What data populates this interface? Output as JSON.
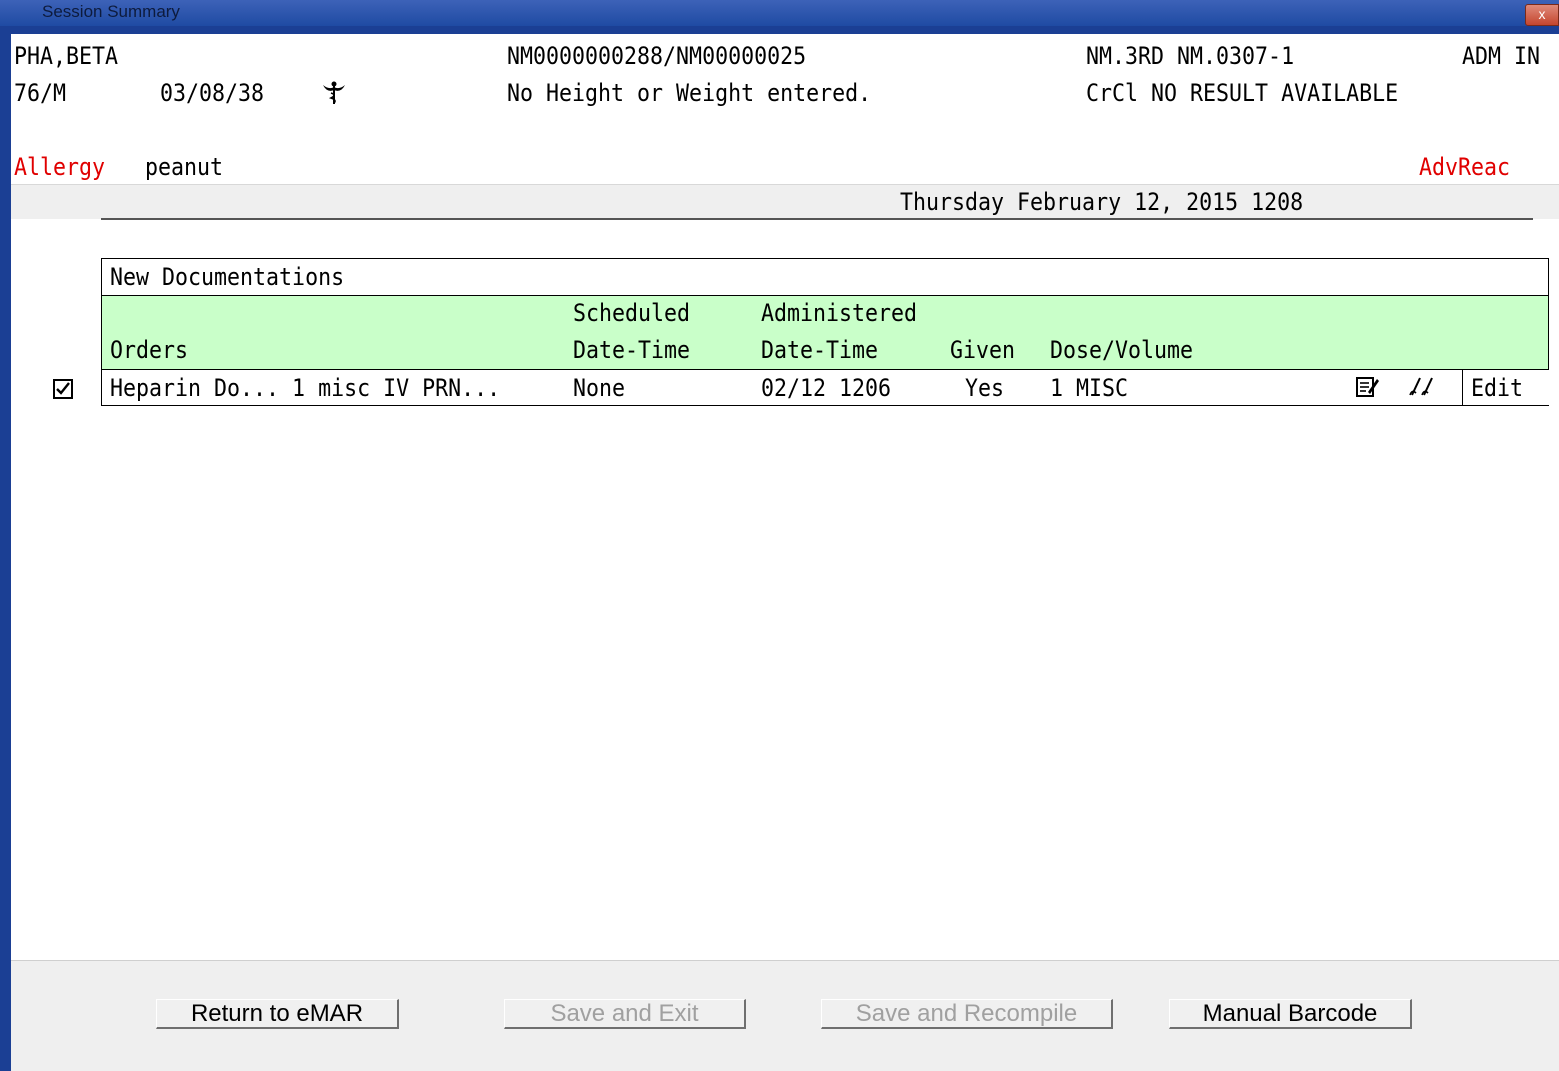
{
  "window": {
    "title": "Session Summary",
    "close_label": "x"
  },
  "patient": {
    "name": "PHA,BETA",
    "age_sex": "76/M",
    "dob": "03/08/38",
    "ids": "NM0000000288/NM00000025",
    "height_weight": "No Height or Weight entered.",
    "location": "NM.3RD NM.0307-1",
    "status": "ADM IN",
    "crcl": "CrCl NO RESULT AVAILABLE",
    "allergy_label": "Allergy",
    "allergy_value": "peanut",
    "adv_reac_label": "AdvReac"
  },
  "datetime": "Thursday February 12, 2015 1208",
  "table": {
    "title": "New Documentations",
    "headers": {
      "orders": "Orders",
      "scheduled_top": "Scheduled",
      "scheduled_bottom": "Date-Time",
      "administered_top": "Administered",
      "administered_bottom": "Date-Time",
      "given": "Given",
      "dose": "Dose/Volume"
    },
    "rows": [
      {
        "checked": true,
        "order": "Heparin Do... 1 misc IV PRN...",
        "scheduled": "None",
        "administered": "02/12 1206",
        "given": "Yes",
        "dose": "1 MISC",
        "edit_label": "Edit"
      }
    ]
  },
  "icons": {
    "caduceus": "caduceus-icon",
    "note": "note-icon",
    "signature": "signature-icon",
    "checkbox": "checkbox-checked-icon"
  },
  "buttons": {
    "return": "Return to eMAR",
    "save_exit": "Save and Exit",
    "save_recompile": "Save and Recompile",
    "manual_barcode": "Manual Barcode"
  },
  "colors": {
    "header_green": "#c9ffc9",
    "alert_red": "#e00000",
    "frame_blue": "#1b3f94"
  }
}
